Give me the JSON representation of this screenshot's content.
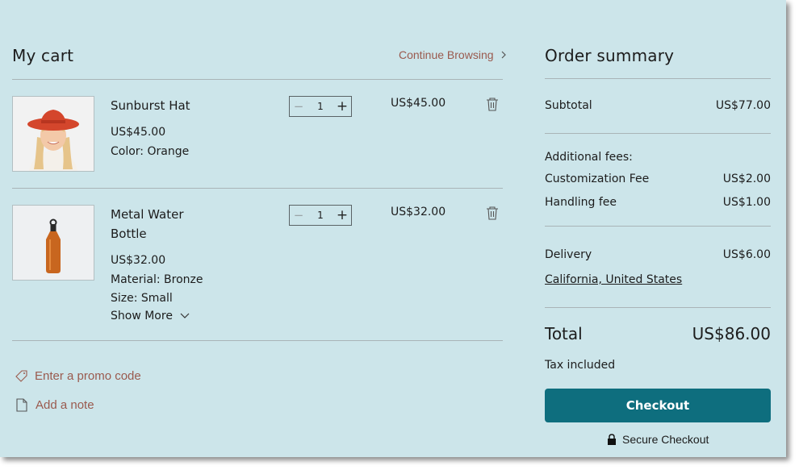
{
  "cart": {
    "title": "My cart",
    "continue_label": "Continue Browsing",
    "items": [
      {
        "name_line1": "Sunburst Hat",
        "name_line2": "",
        "unit_price": "US$45.00",
        "options": [
          "Color: Orange"
        ],
        "quantity": "1",
        "line_total": "US$45.00"
      },
      {
        "name_line1": "Metal Water",
        "name_line2": "Bottle",
        "unit_price": "US$32.00",
        "options": [
          "Material: Bronze",
          "Size: Small"
        ],
        "quantity": "1",
        "line_total": "US$32.00",
        "show_more_label": "Show More"
      }
    ],
    "promo_label": "Enter a promo code",
    "note_label": "Add a note"
  },
  "summary": {
    "title": "Order summary",
    "subtotal_label": "Subtotal",
    "subtotal_value": "US$77.00",
    "additional_fees_label": "Additional fees:",
    "customization_label": "Customization Fee",
    "customization_value": "US$2.00",
    "handling_label": "Handling fee",
    "handling_value": "US$1.00",
    "delivery_label": "Delivery",
    "delivery_value": "US$6.00",
    "delivery_location": "California, United States",
    "total_label": "Total",
    "total_value": "US$86.00",
    "tax_note": "Tax included",
    "checkout_label": "Checkout",
    "secure_label": "Secure Checkout"
  },
  "colors": {
    "background": "#cce5ea",
    "accent": "#0e6e7e",
    "link": "#9a5a4e"
  }
}
